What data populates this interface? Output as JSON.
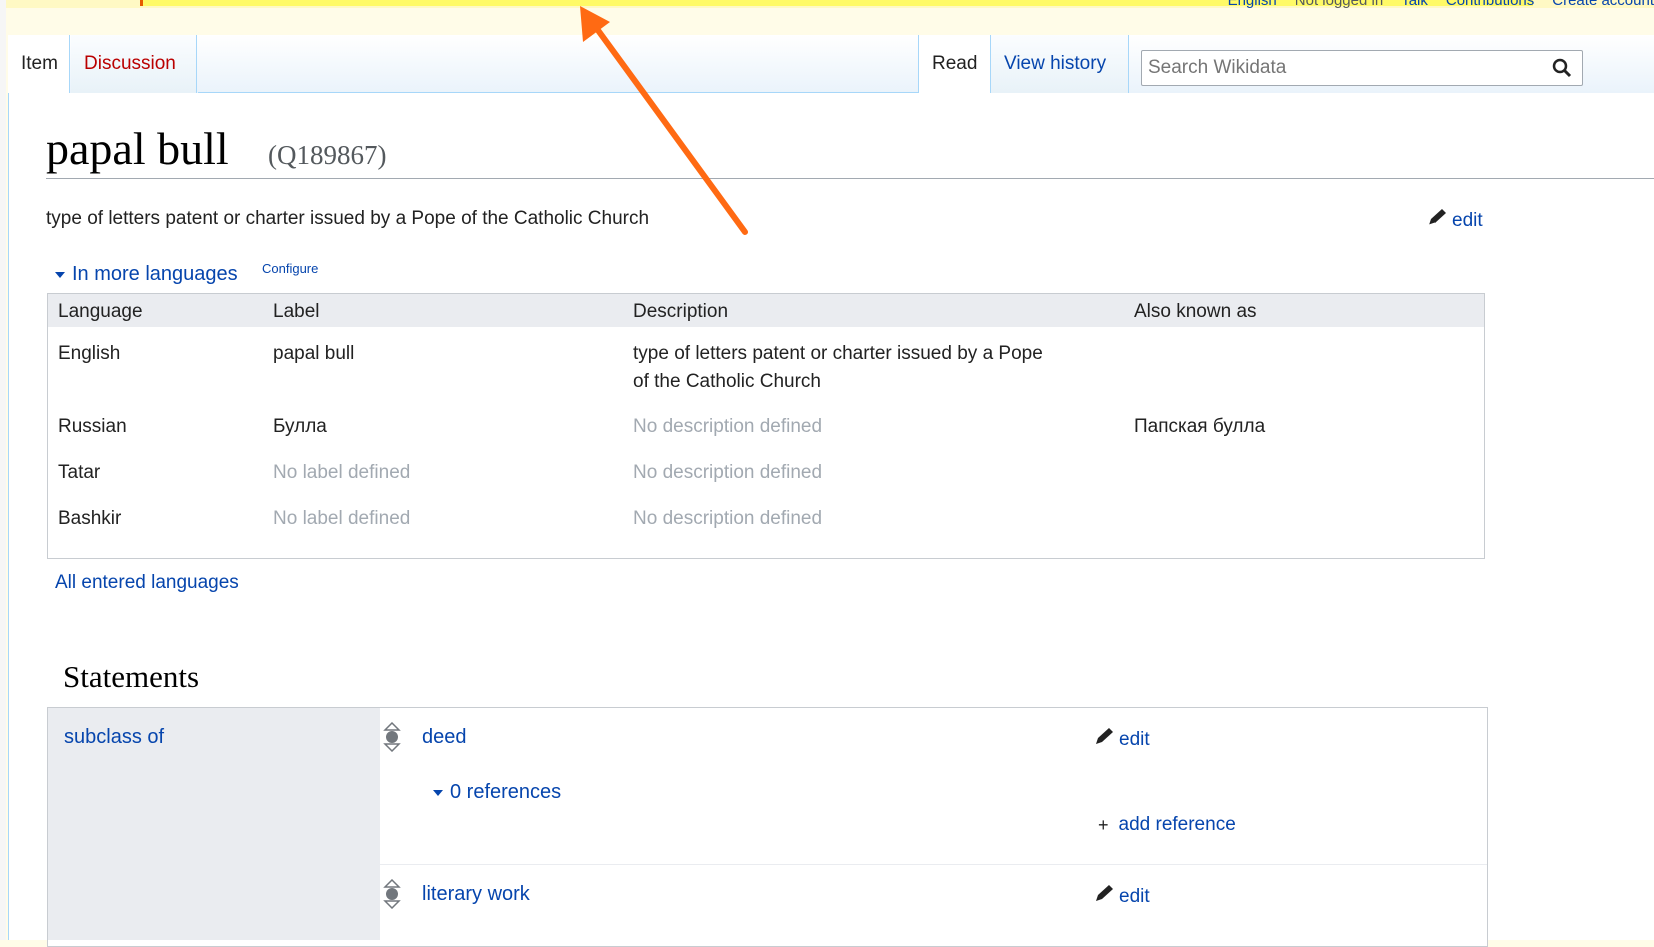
{
  "personal_tools": {
    "language": "English",
    "not_logged_in": "Not logged in",
    "talk": "Talk",
    "contributions": "Contributions",
    "create_account": "Create account"
  },
  "tabs": {
    "item": "Item",
    "discussion": "Discussion",
    "read": "Read",
    "view_history": "View history"
  },
  "search": {
    "placeholder": "Search Wikidata"
  },
  "item": {
    "title": "papal bull",
    "qid": "(Q189867)",
    "description": "type of letters patent or charter issued by a Pope of the Catholic Church",
    "edit_label": "edit"
  },
  "languages": {
    "toggle_label": "In more languages",
    "configure_label": "Configure",
    "headers": [
      "Language",
      "Label",
      "Description",
      "Also known as"
    ],
    "rows": [
      {
        "language": "English",
        "label": "papal bull",
        "description_line1": "type of letters patent or charter issued by a Pope",
        "description_line2": "of the Catholic Church",
        "aliases": ""
      },
      {
        "language": "Russian",
        "label": "Булла",
        "description": "No description defined",
        "aliases": "Папская булла"
      },
      {
        "language": "Tatar",
        "label": "No label defined",
        "description": "No description defined",
        "aliases": ""
      },
      {
        "language": "Bashkir",
        "label": "No label defined",
        "description": "No description defined",
        "aliases": ""
      }
    ],
    "all_entered": "All entered languages"
  },
  "statements": {
    "title": "Statements",
    "property": "subclass of",
    "values": [
      {
        "value": "deed",
        "edit": "edit",
        "references": "0 references",
        "add_reference": "add reference"
      },
      {
        "value": "literary work",
        "edit": "edit"
      }
    ]
  },
  "colors": {
    "link": "#0645ad",
    "annotation_arrow": "#ff6a13",
    "highlight": "#fffa66"
  }
}
